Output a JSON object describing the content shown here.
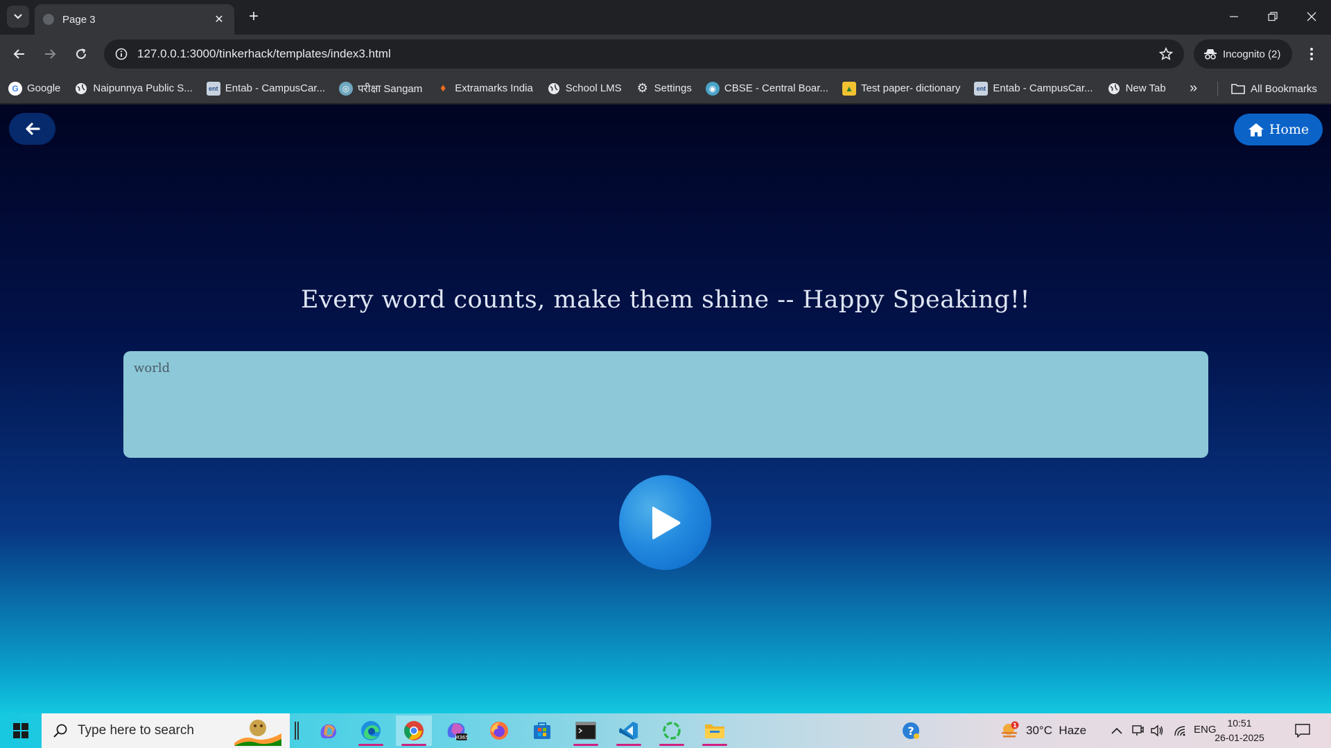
{
  "browser": {
    "tab": {
      "title": "Page 3"
    },
    "url": "127.0.0.1:3000/tinkerhack/templates/index3.html",
    "incognito_label": "Incognito (2)",
    "bookmarks": [
      {
        "label": "Google",
        "icon": "google-icon"
      },
      {
        "label": "Naipunnya Public S...",
        "icon": "globe-icon"
      },
      {
        "label": "Entab - CampusCar...",
        "icon": "entab-icon"
      },
      {
        "label": "परीक्षा Sangam",
        "icon": "pariksha-icon"
      },
      {
        "label": "Extramarks India",
        "icon": "extramarks-icon"
      },
      {
        "label": "School LMS",
        "icon": "globe-icon"
      },
      {
        "label": "Settings",
        "icon": "gear-icon"
      },
      {
        "label": "CBSE - Central Boar...",
        "icon": "cbse-icon"
      },
      {
        "label": "Test paper- dictionary",
        "icon": "image-icon"
      },
      {
        "label": "Entab - CampusCar...",
        "icon": "entab-icon"
      },
      {
        "label": "New Tab",
        "icon": "globe-icon"
      }
    ],
    "all_bookmarks_label": "All Bookmarks"
  },
  "page": {
    "home_label": "Home",
    "headline": "Every word counts, make them shine -- Happy Speaking!!",
    "input_value": "world",
    "colors": {
      "input_bg": "#8cc8d7",
      "home_btn": "#0b63c8",
      "headline": "#dfe6f3"
    }
  },
  "taskbar": {
    "search_placeholder": "Type here to search",
    "weather": "30°C  Haze",
    "weather_badge": "1",
    "language": "ENG",
    "time": "10:51",
    "date": "26-01-2025"
  }
}
